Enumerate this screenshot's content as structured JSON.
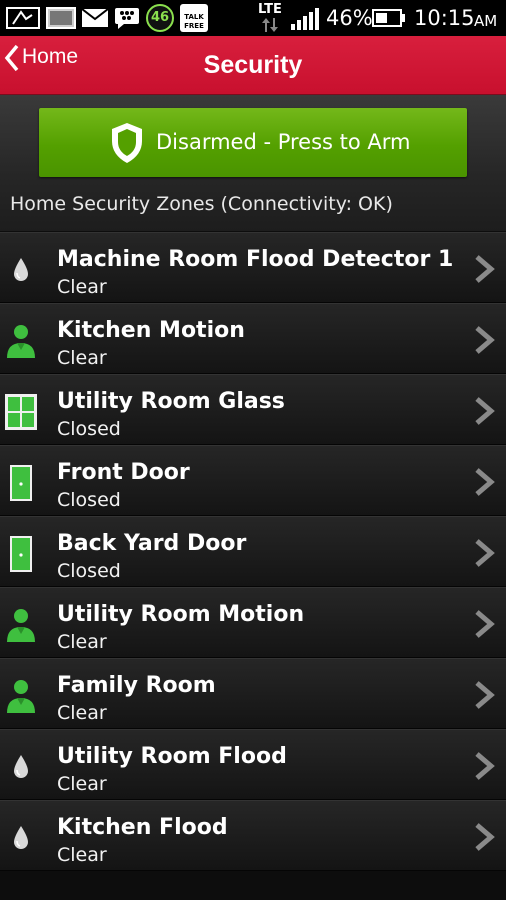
{
  "status_bar": {
    "battery_percent": "46%",
    "time": "10:15",
    "ampm": "AM",
    "network": "LTE",
    "badge_number": "46",
    "talk_free_label": "TALK FREE"
  },
  "header": {
    "back_label": "Home",
    "title": "Security"
  },
  "arm": {
    "label": "Disarmed - Press to Arm"
  },
  "zones_header": "Home Security Zones (Connectivity: OK)",
  "zones": [
    {
      "name": "Machine Room Flood Detector 1",
      "status": "Clear",
      "icon": "flood-icon"
    },
    {
      "name": "Kitchen Motion",
      "status": "Clear",
      "icon": "motion-icon"
    },
    {
      "name": "Utility Room Glass",
      "status": "Closed",
      "icon": "window-icon"
    },
    {
      "name": "Front Door",
      "status": "Closed",
      "icon": "door-icon"
    },
    {
      "name": "Back Yard Door",
      "status": "Closed",
      "icon": "door-icon"
    },
    {
      "name": "Utility Room Motion",
      "status": "Clear",
      "icon": "motion-icon"
    },
    {
      "name": "Family Room",
      "status": "Clear",
      "icon": "motion-icon"
    },
    {
      "name": "Utility Room Flood",
      "status": "Clear",
      "icon": "flood-icon"
    },
    {
      "name": "Kitchen Flood",
      "status": "Clear",
      "icon": "flood-icon"
    }
  ],
  "colors": {
    "header_red": "#c8102e",
    "arm_green": "#54a000",
    "icon_green": "#3fbf3f"
  }
}
